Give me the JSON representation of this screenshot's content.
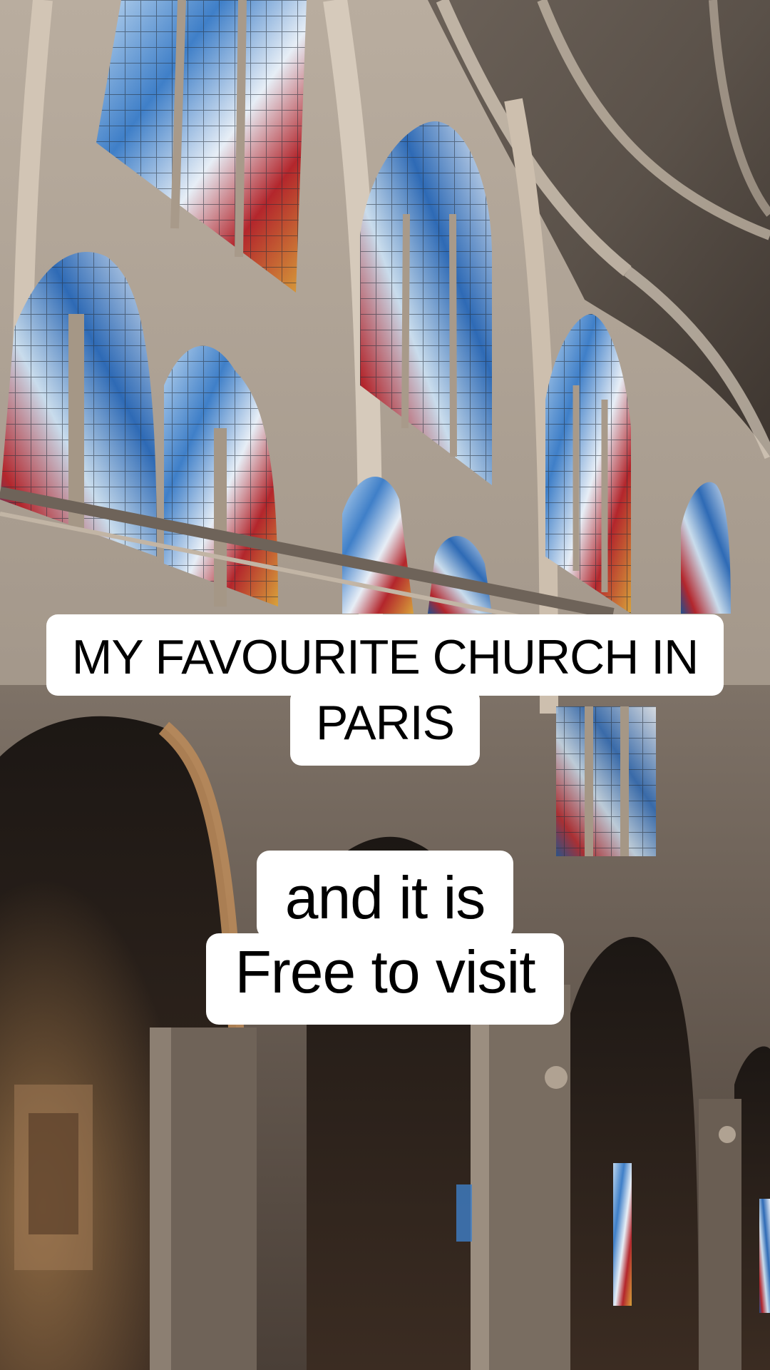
{
  "scene": {
    "description_icon": "cathedral-interior-photo",
    "colors": {
      "stone_light": "#b8aa9a",
      "stone_mid": "#8d8074",
      "stone_dark": "#3a3029",
      "glass_blue": "#3f7fc8",
      "glass_red": "#b3262c",
      "glass_gold": "#d8a23a",
      "caption_bg": "#ffffff",
      "caption_text": "#000000"
    }
  },
  "captions": {
    "title": {
      "line1": "MY FAVOURITE CHURCH IN",
      "line2": "PARIS"
    },
    "subtitle": {
      "line1": "and it is",
      "line2": "Free to visit"
    }
  }
}
